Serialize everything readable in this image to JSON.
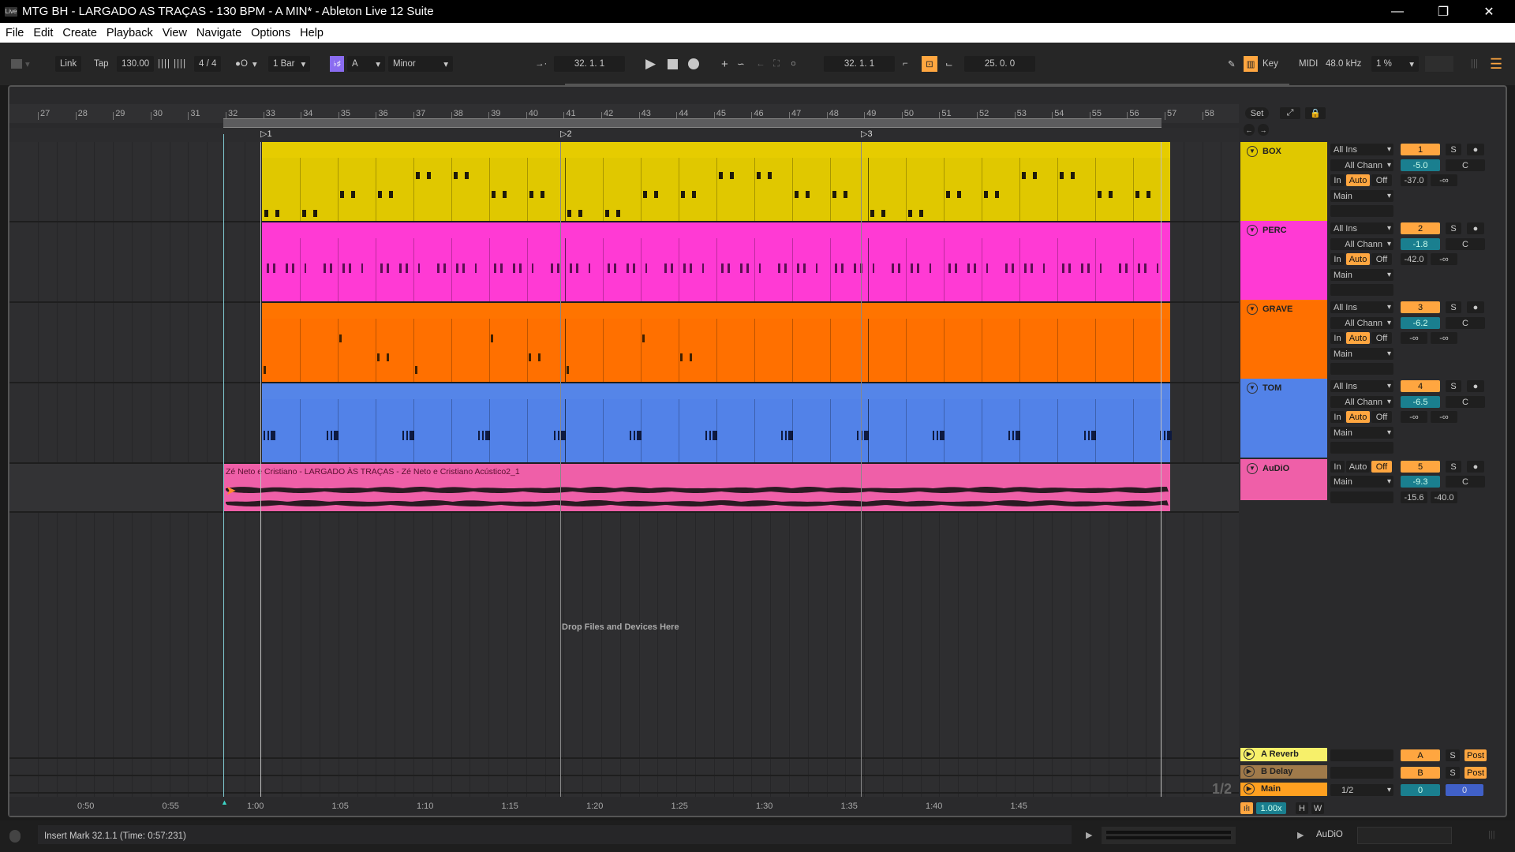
{
  "window": {
    "title": "MTG BH - LARGADO AS TRAÇAS - 130 BPM - A MIN* - Ableton Live 12 Suite",
    "logo": "Live",
    "controls": [
      "minimize-icon",
      "restore-icon",
      "close-icon"
    ]
  },
  "menu": [
    "File",
    "Edit",
    "Create",
    "Playback",
    "View",
    "Navigate",
    "Options",
    "Help"
  ],
  "toolbar": {
    "link": "Link",
    "tap": "Tap",
    "tempo": "130.00",
    "signature": "4 / 4",
    "metronome": "●O",
    "quantize": "1 Bar",
    "scale_root": "A",
    "scale_mode": "Minor",
    "arrangement_position": "32.  1.  1",
    "loop_start": "32.  1.  1",
    "loop_length": "25.  0.  0",
    "key_label": "Key",
    "midi_label": "MIDI",
    "sample_rate": "48.0 kHz",
    "cpu": "1 %"
  },
  "ruler": {
    "bars": [
      "27",
      "28",
      "29",
      "30",
      "31",
      "32",
      "33",
      "34",
      "35",
      "36",
      "37",
      "38",
      "39",
      "40",
      "41",
      "42",
      "43",
      "44",
      "45",
      "46",
      "47",
      "48",
      "49",
      "50",
      "51",
      "52",
      "53",
      "54",
      "55",
      "56",
      "57",
      "58"
    ],
    "locators": [
      "1",
      "2",
      "3"
    ]
  },
  "time_ruler": [
    "0:50",
    "0:55",
    "1:00",
    "1:05",
    "1:10",
    "1:15",
    "1:20",
    "1:25",
    "1:30",
    "1:35",
    "1:40",
    "1:45"
  ],
  "tracks": [
    {
      "name": "BOX",
      "color": "#e0c800",
      "input": "All Ins",
      "channel": "All Channels",
      "channel_short": "All Chann",
      "monitor": [
        "In",
        "Auto",
        "Off"
      ],
      "monitor_active": "Auto",
      "output": "Main",
      "number": "1",
      "solo": "S",
      "volume": "-5.0",
      "pan": "C",
      "peak_a": "-37.0",
      "peak_b": "-∞",
      "arm": "●"
    },
    {
      "name": "PERC",
      "color": "#ff3ad4",
      "input": "All Ins",
      "channel": "All Channels",
      "channel_short": "All Chann",
      "monitor": [
        "In",
        "Auto",
        "Off"
      ],
      "monitor_active": "Auto",
      "output": "Main",
      "number": "2",
      "solo": "S",
      "volume": "-1.8",
      "pan": "C",
      "peak_a": "-42.0",
      "peak_b": "-∞",
      "arm": "●"
    },
    {
      "name": "GRAVE",
      "color": "#ff7000",
      "input": "All Ins",
      "channel": "All Channels",
      "channel_short": "All Chann",
      "monitor": [
        "In",
        "Auto",
        "Off"
      ],
      "monitor_active": "Auto",
      "output": "Main",
      "number": "3",
      "solo": "S",
      "volume": "-6.2",
      "pan": "C",
      "peak_a": "-∞",
      "peak_b": "-∞",
      "arm": "●"
    },
    {
      "name": "TOM",
      "color": "#5282e8",
      "input": "All Ins",
      "channel": "All Channels",
      "channel_short": "All Chann",
      "monitor": [
        "In",
        "Auto",
        "Off"
      ],
      "monitor_active": "Auto",
      "output": "Main",
      "number": "4",
      "solo": "S",
      "volume": "-6.5",
      "pan": "C",
      "peak_a": "-∞",
      "peak_b": "-∞",
      "arm": "●"
    },
    {
      "name": "AuDiO",
      "color": "#ef5fa8",
      "monitor": [
        "In",
        "Auto",
        "Off"
      ],
      "monitor_active": "Off",
      "output": "Main",
      "number": "5",
      "solo": "S",
      "volume": "-9.3",
      "pan": "C",
      "peak_a": "-15.6",
      "peak_b": "-40.0",
      "arm": "●",
      "clip_name": "Zé Neto e Cristiano - LARGADO ÀS TRAÇAS - Zé Neto e Cristiano Acústico2_1"
    }
  ],
  "drop_hint": "Drop Files and Devices Here",
  "returns": [
    {
      "name": "A Reverb",
      "color": "#f7f06a",
      "send": "A",
      "solo": "S",
      "mode": "Post"
    },
    {
      "name": "B Delay",
      "color": "#a07a4a",
      "send": "B",
      "solo": "S",
      "mode": "Post"
    }
  ],
  "main": {
    "name": "Main",
    "color": "#ffa020",
    "cue": "1/2",
    "vol": "0",
    "pan": "0",
    "page": "1/2"
  },
  "mixer_header": {
    "set": "Set"
  },
  "bottom_controls": {
    "speed": "1.00x",
    "h": "H",
    "w": "W"
  },
  "status": {
    "message": "Insert Mark 32.1.1 (Time: 0:57:231)",
    "selected_track": "AuDiO"
  }
}
